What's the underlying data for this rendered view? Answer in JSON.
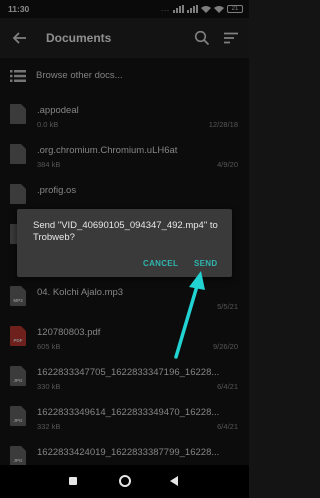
{
  "status_bar": {
    "time": "11:30",
    "dots": "...",
    "battery": "21"
  },
  "app_bar": {
    "title": "Documents",
    "icons": [
      "arrow-left-icon",
      "search-icon",
      "sort-icon"
    ]
  },
  "browse": {
    "label": "Browse other docs...",
    "icon": "list-icon"
  },
  "files": [
    {
      "name": ".appodeal",
      "size": "0.0 kB",
      "date": "12/28/18",
      "type": ""
    },
    {
      "name": ".org.chromium.Chromium.uLH6at",
      "size": "384 kB",
      "date": "4/9/20",
      "type": ""
    },
    {
      "name": ".profig.os",
      "size": "",
      "date": "",
      "type": ""
    },
    {
      "name": "",
      "size": "",
      "date": "",
      "type": ""
    },
    {
      "name": "04. Kolchi Ajalo.mp3",
      "size": "",
      "date": "5/5/21",
      "type": "MP3"
    },
    {
      "name": "120780803.pdf",
      "size": "605 kB",
      "date": "9/26/20",
      "type": "PDF"
    },
    {
      "name": "1622833347705_1622833347196_16228...",
      "size": "330 kB",
      "date": "6/4/21",
      "type": "JPG"
    },
    {
      "name": "1622833349614_1622833349470_16228...",
      "size": "332 kB",
      "date": "6/4/21",
      "type": "JPG"
    },
    {
      "name": "1622833424019_1622833387799_16228...",
      "size": "",
      "date": "",
      "type": "JPG"
    }
  ],
  "dialog": {
    "message": "Send \"VID_40690105_094347_492.mp4\" to Trobweb?",
    "cancel_label": "CANCEL",
    "send_label": "SEND"
  },
  "colors": {
    "accent": "#2fb5ae",
    "arrow": "#22d3d3",
    "pdf": "#b0352e"
  },
  "nav_bar": {
    "icons": [
      "recent-apps-icon",
      "home-icon",
      "back-icon"
    ]
  }
}
